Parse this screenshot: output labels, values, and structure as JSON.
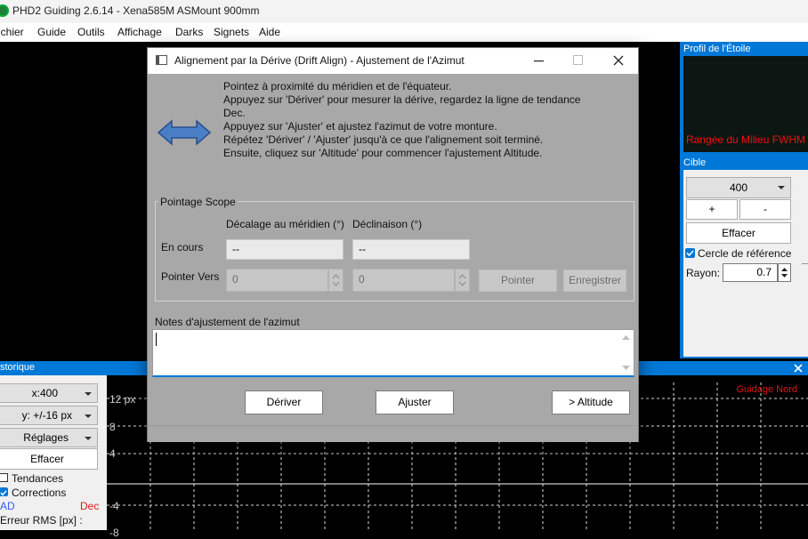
{
  "app": {
    "title": "PHD2 Guiding 2.6.14 - Xena585M ASMount 900mm",
    "menu": [
      "ichier",
      "Guide",
      "Outils",
      "Affichage",
      "Darks",
      "Signets",
      "Aide"
    ]
  },
  "star_profile": {
    "header": "Profil de l'Étoile",
    "label": "Rangée du Milieu FWHM"
  },
  "target": {
    "header": "Cible",
    "zoom_value": "400",
    "plus_label": "+",
    "minus_label": "-",
    "clear_label": "Effacer",
    "reference_circle_label": "Cercle de référence",
    "reference_circle_checked": true,
    "radius_label": "Rayon:",
    "radius_value": "0.7"
  },
  "history": {
    "header": "storique",
    "x_scale": "x:400",
    "y_scale": "y: +/-16 px",
    "settings_label": "Réglages",
    "clear_label": "Effacer",
    "trends_label": "Tendances",
    "corrections_label": "Corrections",
    "ra_label": "AD",
    "dec_label": "Dec",
    "rms_label": "Erreur RMS [px] :",
    "guide_direction": "Guidage Nord",
    "y_ticks": [
      "12 px",
      "8",
      "4",
      "-4",
      "-8"
    ],
    "ra_color": "#3a5cff",
    "dec_color": "#e01818"
  },
  "dialog": {
    "title": "Alignement par la Dérive (Drift Align) - Ajustement de l'Azimut",
    "instructions": [
      "Pointez à proximité du méridien et de l'équateur.",
      "Appuyez sur 'Dériver' pour mesurer la dérive, regardez la ligne de tendance",
      "Dec.",
      "Appuyez sur 'Ajuster' et ajustez l'azimut de votre monture.",
      "Répétez 'Dériver' / 'Ajuster' jusqu'à ce que l'alignement soit terminé.",
      "Ensuite, cliquez sur 'Altitude' pour commencer l'ajustement Altitude."
    ],
    "scope_group_label": "Pointage Scope",
    "col_meridian": "Décalage au méridien (°)",
    "col_declination": "Déclinaison (°)",
    "current_label": "En cours",
    "current_meridian": "--",
    "current_declination": "--",
    "point_to_label": "Pointer Vers",
    "point_to_meridian": "0",
    "point_to_declination": "0",
    "point_button": "Pointer",
    "save_button": "Enregistrer",
    "notes_label": "Notes d'ajustement de l'azimut",
    "notes_value": "",
    "drift_button": "Dériver",
    "adjust_button": "Ajuster",
    "altitude_button": "> Altitude"
  }
}
